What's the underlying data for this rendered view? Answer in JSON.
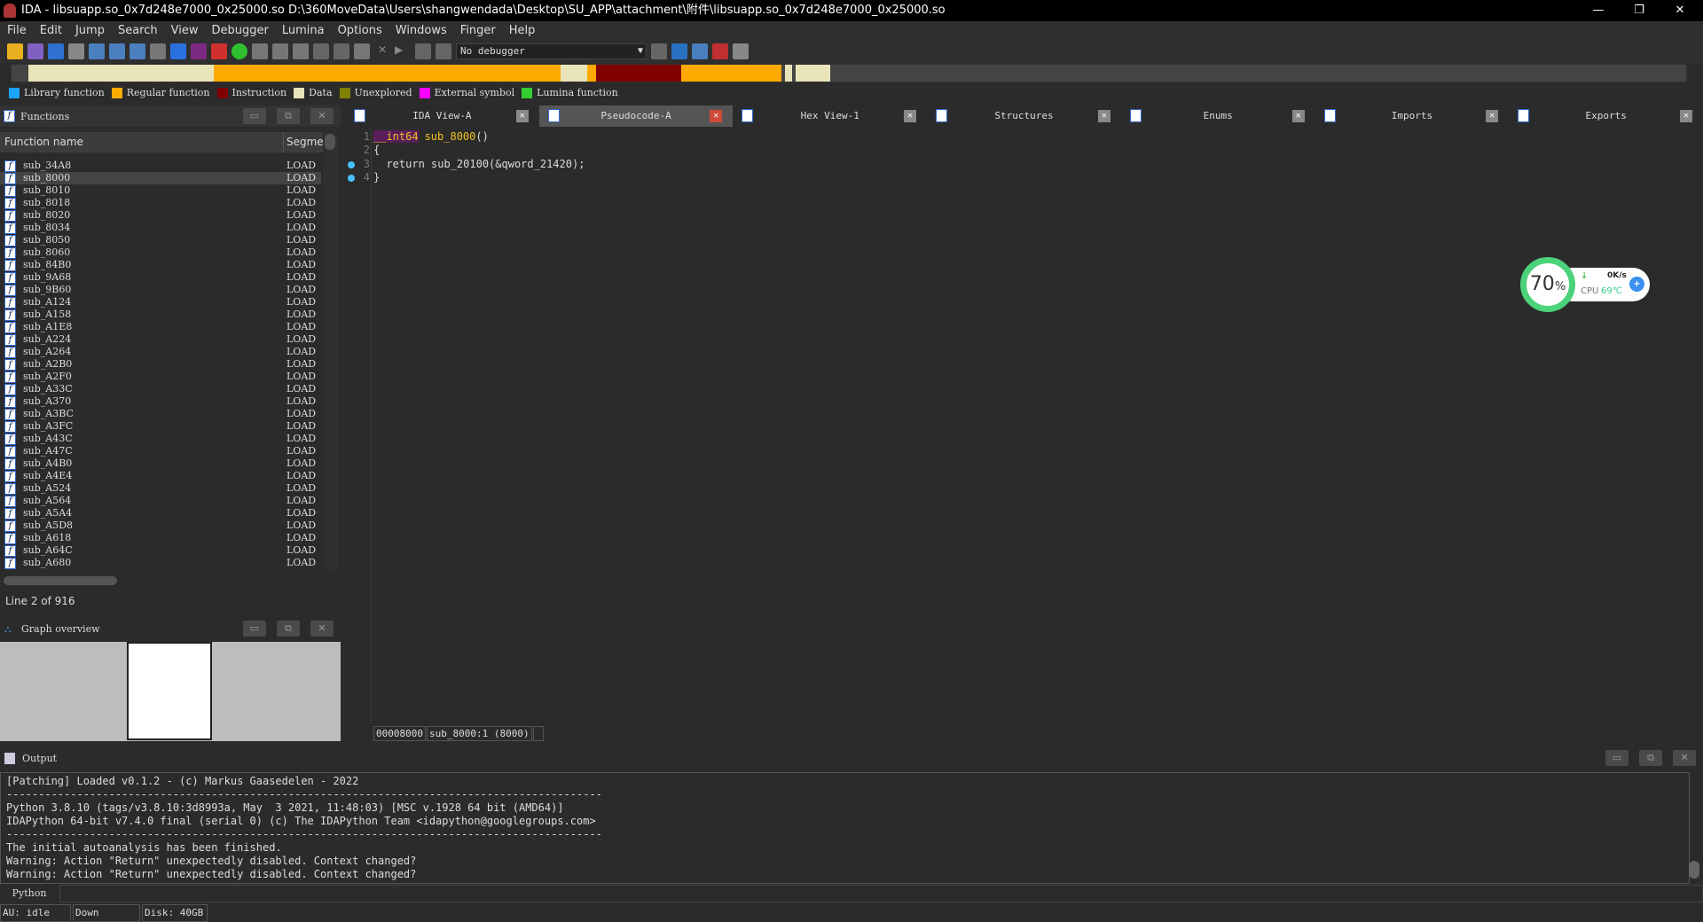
{
  "window": {
    "title": "IDA - libsuapp.so_0x7d248e7000_0x25000.so D:\\360MoveData\\Users\\shangwendada\\Desktop\\SU_APP\\attachment\\附件\\libsuapp.so_0x7d248e7000_0x25000.so",
    "minimize": "—",
    "restore": "❐",
    "close": "✕"
  },
  "menu": [
    "File",
    "Edit",
    "Jump",
    "Search",
    "View",
    "Debugger",
    "Lumina",
    "Options",
    "Windows",
    "Finger",
    "Help"
  ],
  "toolbar": {
    "debugger_select": "No debugger"
  },
  "navband": {
    "colors": {
      "data": "#e8e4b8",
      "regular": "#ffaa00",
      "instruction": "#800000"
    }
  },
  "legend": [
    {
      "label": "Library function",
      "color": "#1aa3ff"
    },
    {
      "label": "Regular function",
      "color": "#ffaa00"
    },
    {
      "label": "Instruction",
      "color": "#800000"
    },
    {
      "label": "Data",
      "color": "#e8e4b8"
    },
    {
      "label": "Unexplored",
      "color": "#808000"
    },
    {
      "label": "External symbol",
      "color": "#ff00ff"
    },
    {
      "label": "Lumina function",
      "color": "#33cc33"
    }
  ],
  "functions": {
    "title": "Functions",
    "col_name": "Function name",
    "col_segment": "Segme",
    "selected": "sub_8000",
    "rows": [
      "sub_34A8",
      "sub_8000",
      "sub_8010",
      "sub_8018",
      "sub_8020",
      "sub_8034",
      "sub_8050",
      "sub_8060",
      "sub_84B0",
      "sub_9A68",
      "sub_9B60",
      "sub_A124",
      "sub_A158",
      "sub_A1E8",
      "sub_A224",
      "sub_A264",
      "sub_A2B0",
      "sub_A2F0",
      "sub_A33C",
      "sub_A370",
      "sub_A3BC",
      "sub_A3FC",
      "sub_A43C",
      "sub_A47C",
      "sub_A4B0",
      "sub_A4E4",
      "sub_A524",
      "sub_A564",
      "sub_A5A4",
      "sub_A5D8",
      "sub_A618",
      "sub_A64C",
      "sub_A680"
    ],
    "segment": "LOAD",
    "line_info": "Line 2 of 916"
  },
  "graph_overview": {
    "title": "Graph overview"
  },
  "tabs": [
    {
      "label": "IDA View-A",
      "active": false
    },
    {
      "label": "Pseudocode-A",
      "active": true
    },
    {
      "label": "Hex View-1",
      "active": false
    },
    {
      "label": "Structures",
      "active": false
    },
    {
      "label": "Enums",
      "active": false
    },
    {
      "label": "Imports",
      "active": false
    },
    {
      "label": "Exports",
      "active": false
    }
  ],
  "code": {
    "lines": [
      {
        "n": "1",
        "type": "__int64",
        "name": "sub_8000",
        "rest": "()",
        "bp": false
      },
      {
        "n": "2",
        "text": "{",
        "bp": false
      },
      {
        "n": "3",
        "text": "  return sub_20100(&qword_21420);",
        "bp": true
      },
      {
        "n": "4",
        "text": "}",
        "bp": true
      }
    ],
    "status": [
      "00008000",
      "sub_8000:1 (8000)"
    ]
  },
  "widget": {
    "percent": "70",
    "unit": "%",
    "speed": "0K/s",
    "cpu_label": "CPU",
    "cpu_temp": "69℃"
  },
  "output": {
    "title": "Output",
    "lines": [
      "[Patching] Loaded v0.1.2 - (c) Markus Gaasedelen - 2022",
      "---------------------------------------------------------------------------------------------",
      "Python 3.8.10 (tags/v3.8.10:3d8993a, May  3 2021, 11:48:03) [MSC v.1928 64 bit (AMD64)]",
      "IDAPython 64-bit v7.4.0 final (serial 0) (c) The IDAPython Team <idapython@googlegroups.com>",
      "---------------------------------------------------------------------------------------------",
      "The initial autoanalysis has been finished.",
      "Warning: Action \"Return\" unexpectedly disabled. Context changed?",
      "Warning: Action \"Return\" unexpectedly disabled. Context changed?"
    ],
    "lang": "Python"
  },
  "statusbar": {
    "au": "AU:  idle",
    "dir": "Down    ",
    "disk": "Disk: 40GB"
  }
}
